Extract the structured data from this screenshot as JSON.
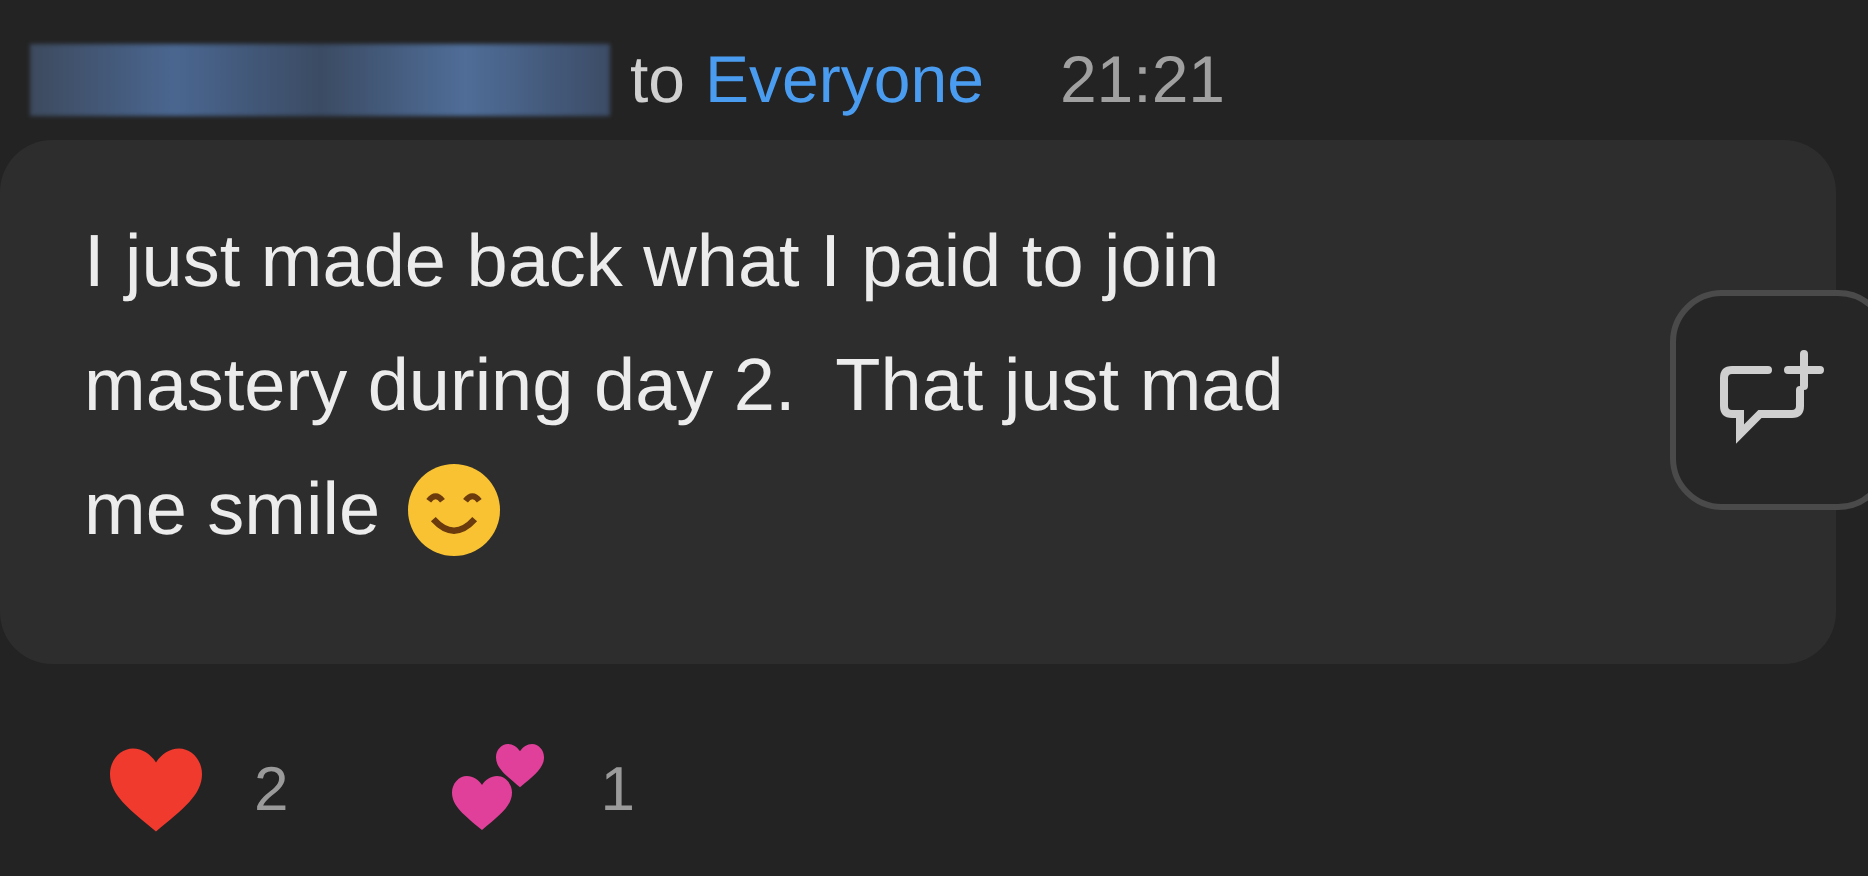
{
  "header": {
    "to": "to",
    "recipient": "Everyone",
    "time": "21:21"
  },
  "message": {
    "lines": [
      "I just made back what I paid to join",
      "mastery during day 2.  That just mad",
      "me smile"
    ]
  },
  "reactions": [
    {
      "kind": "heart",
      "count": "2"
    },
    {
      "kind": "two-hearts",
      "count": "1"
    }
  ]
}
